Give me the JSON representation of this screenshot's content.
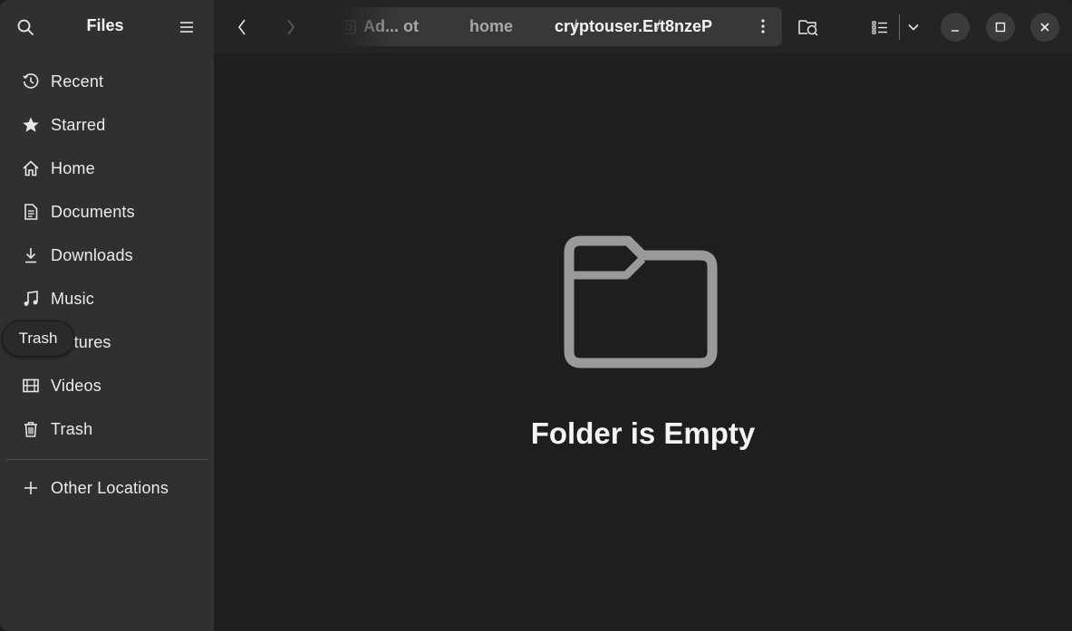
{
  "sidebar": {
    "title": "Files",
    "items": [
      {
        "label": "Recent",
        "icon": "clock-icon"
      },
      {
        "label": "Starred",
        "icon": "star-icon"
      },
      {
        "label": "Home",
        "icon": "home-icon"
      },
      {
        "label": "Documents",
        "icon": "document-icon"
      },
      {
        "label": "Downloads",
        "icon": "download-icon"
      },
      {
        "label": "Music",
        "icon": "music-icon"
      },
      {
        "label": "Pictures",
        "icon": "picture-icon"
      },
      {
        "label": "Videos",
        "icon": "video-icon"
      },
      {
        "label": "Trash",
        "icon": "trash-icon"
      }
    ],
    "other_locations": "Other Locations"
  },
  "tooltip": {
    "text": "Trash"
  },
  "pathbar": {
    "root": "Ad... ot",
    "sep": "/",
    "home": "home",
    "current": "cryptouser.Ert8nzeP"
  },
  "content": {
    "empty_title": "Folder is Empty"
  },
  "colors": {
    "sidebar_bg": "#303030",
    "header_bg": "#242424",
    "content_bg": "#1e1e1e",
    "pathbar_bg": "#383838"
  }
}
